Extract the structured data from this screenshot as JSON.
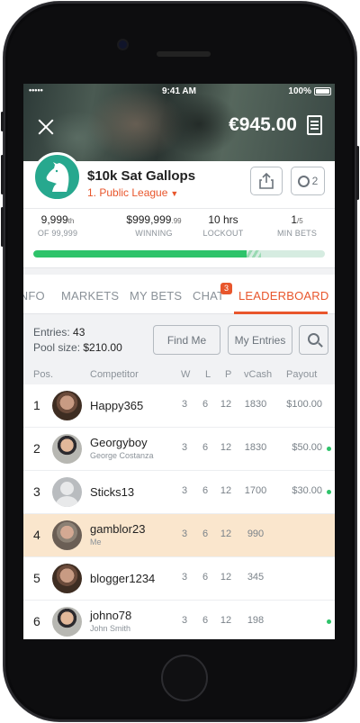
{
  "status_bar": {
    "signal": "••••• ",
    "time": "9:41 AM",
    "battery": "100%"
  },
  "hero": {
    "balance": "€945.00"
  },
  "contest": {
    "title": "$10k Sat Gallops",
    "league": "1. Public League",
    "entries_badge": "2"
  },
  "stats": [
    {
      "value": "9,999",
      "suffix": "th",
      "label": "OF 99,999"
    },
    {
      "value": "$999,999",
      "suffix": ".99",
      "label": "WINNING"
    },
    {
      "value": "10 hrs",
      "suffix": "",
      "label": "LOCKOUT"
    },
    {
      "value": "1",
      "suffix": "/5",
      "label": "MIN BETS"
    }
  ],
  "progress": {
    "fill_fraction": 0.73,
    "pending_fraction": 0.05
  },
  "tabs": [
    {
      "label": "INFO"
    },
    {
      "label": "MARKETS"
    },
    {
      "label": "MY BETS"
    },
    {
      "label": "CHAT"
    },
    {
      "label": "LEADERBOARD"
    }
  ],
  "chat_badge": "3",
  "entries": {
    "entries_label": "Entries:",
    "entries_value": "43",
    "pool_label": "Pool size:",
    "pool_value": "$210.00",
    "find_me": "Find Me",
    "my_entries": "My Entries"
  },
  "columns": {
    "pos": "Pos.",
    "competitor": "Competitor",
    "w": "W",
    "l": "L",
    "p": "P",
    "vcash": "vCash",
    "payout": "Payout"
  },
  "leaderboard": [
    {
      "pos": "1",
      "name": "Happy365",
      "sub": "",
      "w": "3",
      "l": "6",
      "p": "12",
      "vcash": "1830",
      "payout": "$100.00",
      "dot": false
    },
    {
      "pos": "2",
      "name": "Georgyboy",
      "sub": "George Costanza",
      "w": "3",
      "l": "6",
      "p": "12",
      "vcash": "1830",
      "payout": "$50.00",
      "dot": true
    },
    {
      "pos": "3",
      "name": "Sticks13",
      "sub": "",
      "w": "3",
      "l": "6",
      "p": "12",
      "vcash": "1700",
      "payout": "$30.00",
      "dot": true
    },
    {
      "pos": "4",
      "name": "gamblor23",
      "sub": "Me",
      "w": "3",
      "l": "6",
      "p": "12",
      "vcash": "990",
      "payout": "",
      "dot": false
    },
    {
      "pos": "5",
      "name": "blogger1234",
      "sub": "",
      "w": "3",
      "l": "6",
      "p": "12",
      "vcash": "345",
      "payout": "",
      "dot": false
    },
    {
      "pos": "6",
      "name": "johno78",
      "sub": "John Smith",
      "w": "3",
      "l": "6",
      "p": "12",
      "vcash": "198",
      "payout": "",
      "dot": true
    }
  ]
}
